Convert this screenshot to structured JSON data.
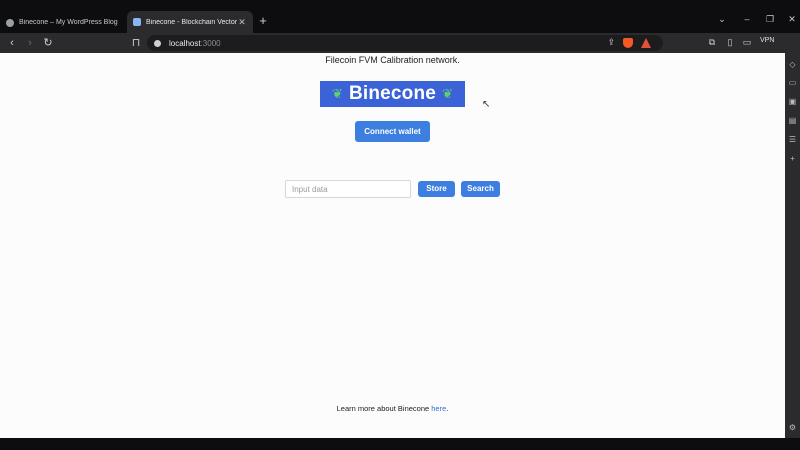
{
  "tabs": [
    {
      "title": "Binecone – My WordPress Blog",
      "active": false
    },
    {
      "title": "Binecone - Blockchain Vector DB",
      "active": true
    }
  ],
  "toolbar": {
    "url_host": "localhost",
    "url_port": ":3000",
    "vpn_label": "VPN"
  },
  "page": {
    "network_label": "Filecoin FVM Calibration network.",
    "logo_text": "Binecone",
    "connect_label": "Connect wallet",
    "input_placeholder": "Input data",
    "store_label": "Store",
    "search_label": "Search",
    "footer_text": "Learn more about Binecone ",
    "footer_link": "here",
    "footer_end": "."
  },
  "colors": {
    "accent": "#3c7fe0",
    "logo_bg": "#3c62d7",
    "brave_orange": "#f55a24"
  },
  "icons": [
    "globe-icon",
    "tab-favicon-icon",
    "close-icon",
    "plus-icon",
    "chevron-down-icon",
    "minimize-icon",
    "maximize-icon",
    "back-icon",
    "forward-icon",
    "reload-icon",
    "bookmark-icon",
    "info-icon",
    "share-icon",
    "brave-shield-icon",
    "brave-rewards-icon",
    "extensions-icon",
    "sidebar-icon",
    "wallet-icon",
    "leaf-icon",
    "cursor-icon",
    "settings-icon"
  ]
}
